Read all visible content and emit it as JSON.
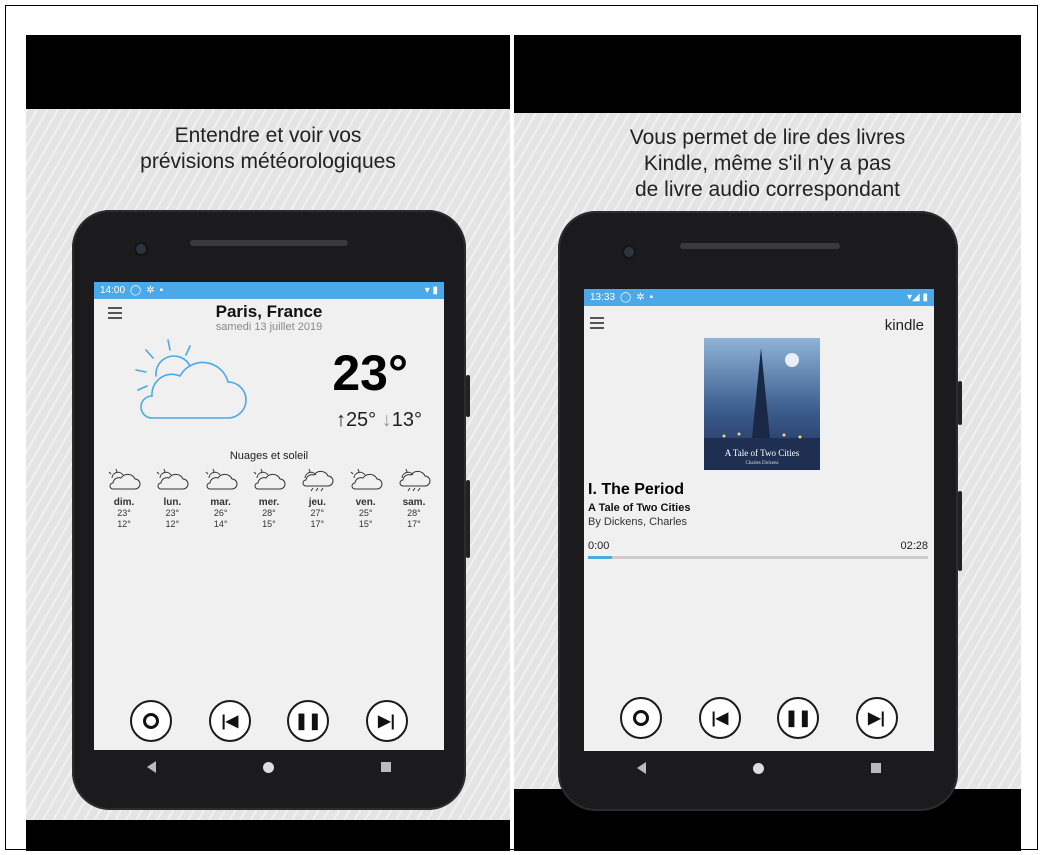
{
  "left": {
    "caption_line1": "Entendre et voir vos",
    "caption_line2": "prévisions météorologiques",
    "status_time": "14:00",
    "city": "Paris, France",
    "date": "samedi 13 juillet 2019",
    "temperature": "23°",
    "high": "25°",
    "low": "13°",
    "condition": "Nuages et soleil",
    "forecast": [
      {
        "day": "dim.",
        "high": "23°",
        "low": "12°",
        "icon": "cloud-sun-icon"
      },
      {
        "day": "lun.",
        "high": "23°",
        "low": "12°",
        "icon": "cloud-sun-icon"
      },
      {
        "day": "mar.",
        "high": "26°",
        "low": "14°",
        "icon": "cloud-sun-icon"
      },
      {
        "day": "mer.",
        "high": "28°",
        "low": "15°",
        "icon": "cloud-sun-icon"
      },
      {
        "day": "jeu.",
        "high": "27°",
        "low": "17°",
        "icon": "cloud-rain-icon"
      },
      {
        "day": "ven.",
        "high": "25°",
        "low": "15°",
        "icon": "cloud-sun-icon"
      },
      {
        "day": "sam.",
        "high": "28°",
        "low": "17°",
        "icon": "cloud-rain-icon"
      }
    ]
  },
  "right": {
    "caption_line1": "Vous permet de lire des livres",
    "caption_line2": "Kindle, même s'il n'y a pas",
    "caption_line3": "de livre audio correspondant",
    "status_time": "13:33",
    "brand": "kindle",
    "cover_title": "A Tale of Two Cities",
    "cover_author": "Charles Dickens",
    "chapter": "I. The Period",
    "book_title": "A Tale of Two Cities",
    "author": "By Dickens, Charles",
    "elapsed": "0:00",
    "total": "02:28",
    "progress_fraction": 0.07
  },
  "colors": {
    "status_bar": "#4aa9e6",
    "progress": "#4aa9e6",
    "weather_icon_outline": "#4aa9e6"
  },
  "icons": {
    "controls": [
      "alexa-ring-icon",
      "previous-icon",
      "pause-icon",
      "next-icon"
    ],
    "navbar": [
      "back-icon",
      "home-icon",
      "recents-icon"
    ]
  }
}
